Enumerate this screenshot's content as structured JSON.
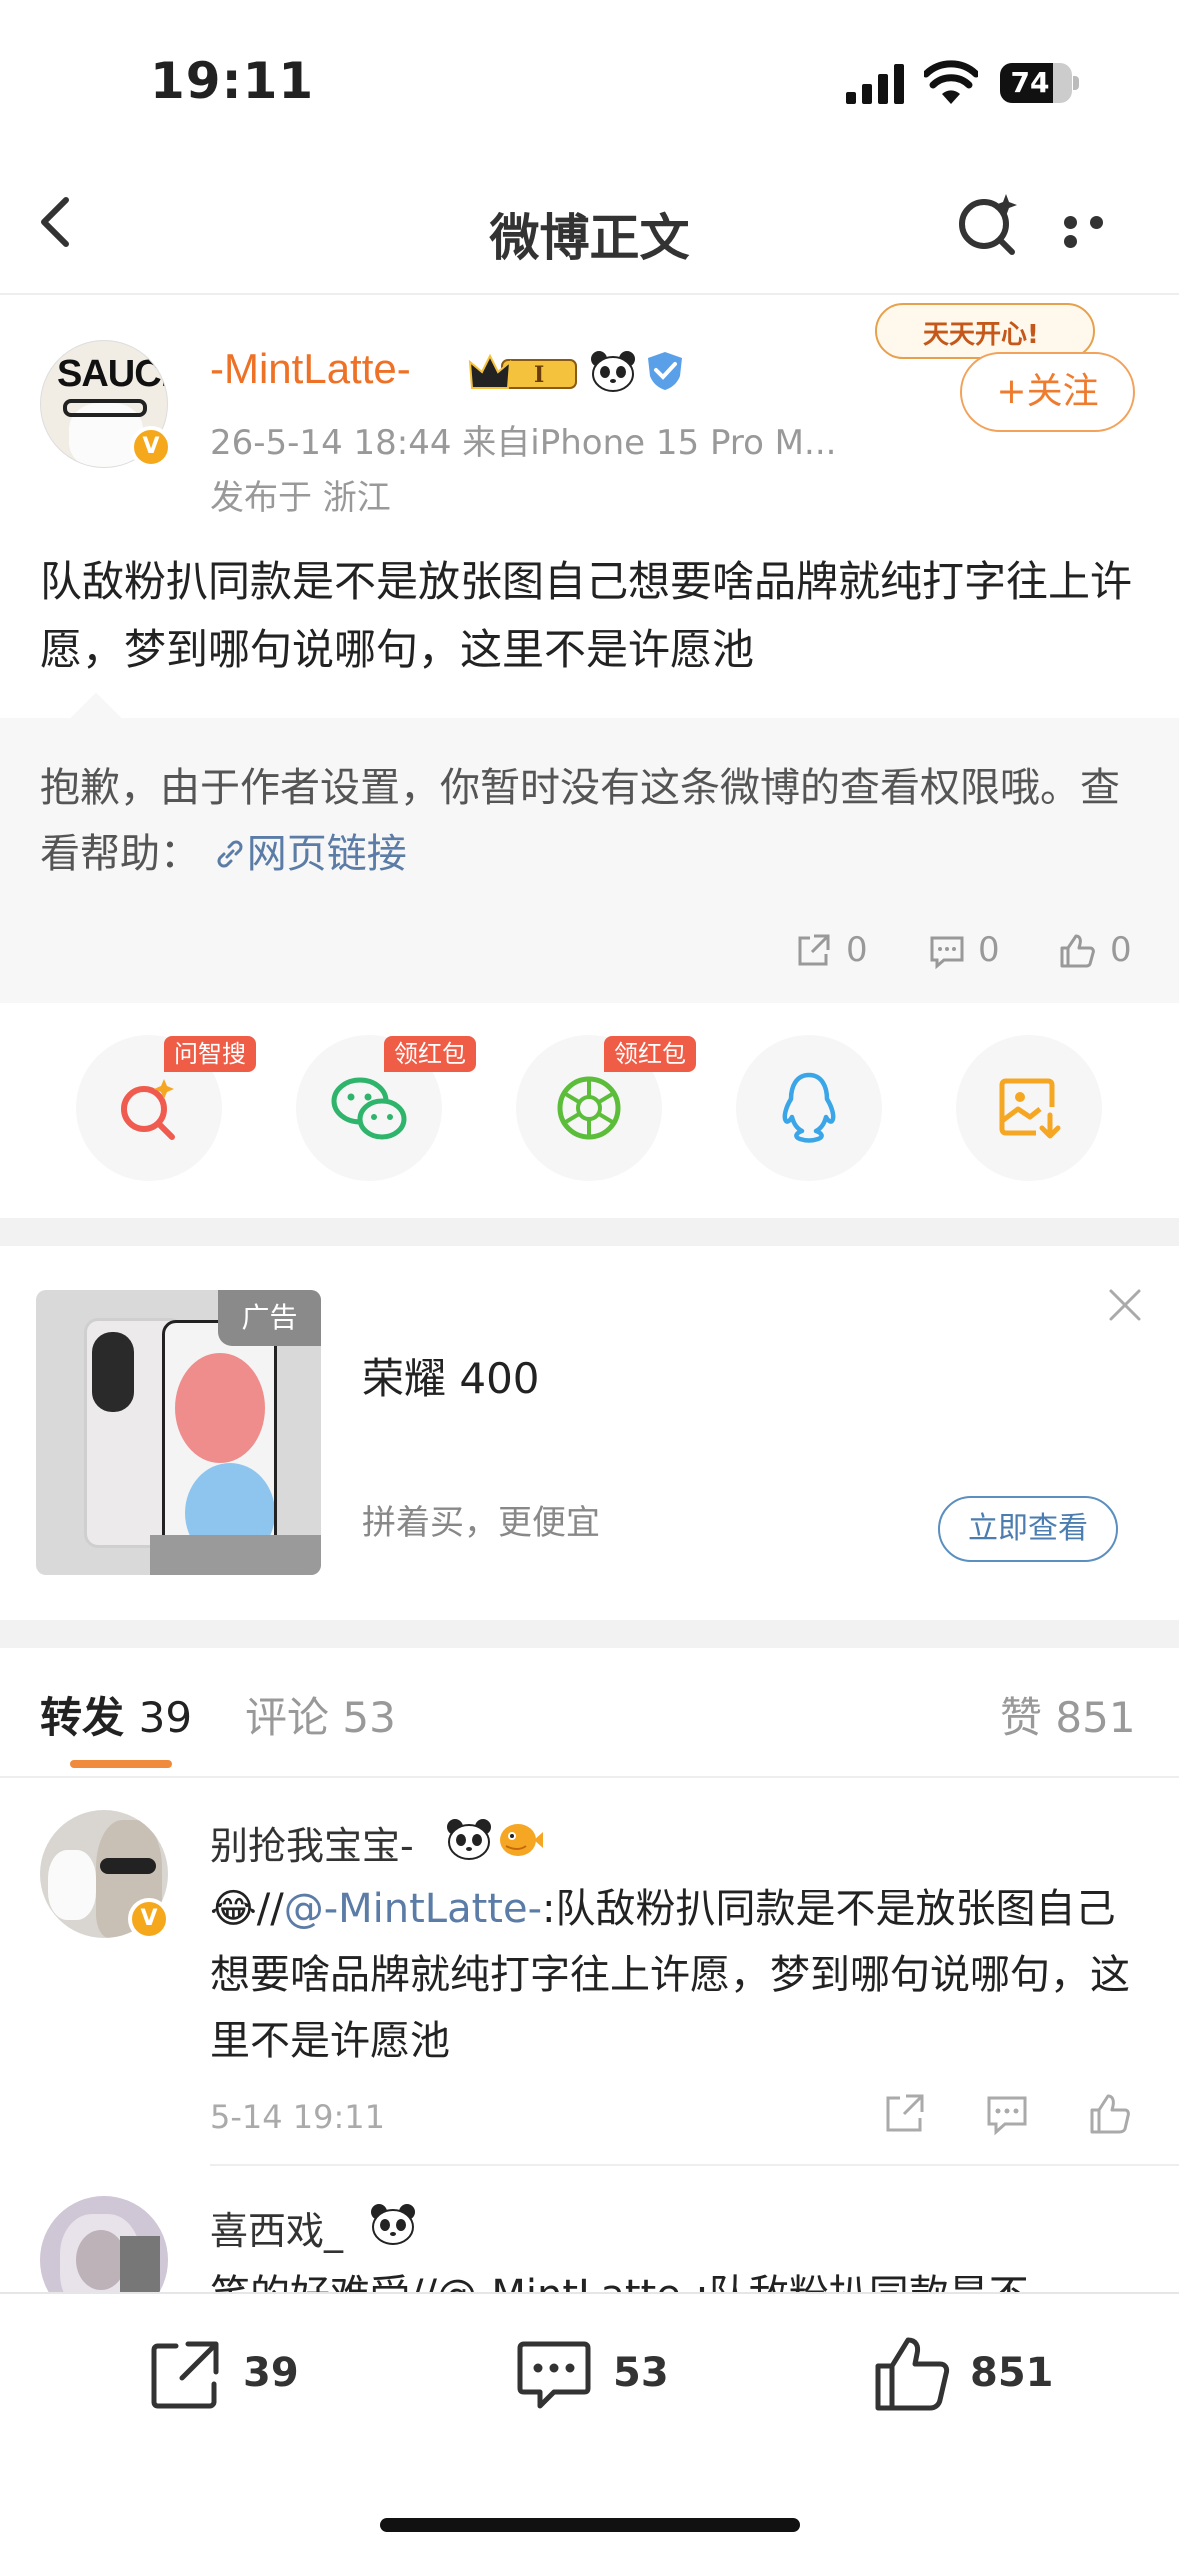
{
  "status_bar": {
    "time": "19:11",
    "battery": "74"
  },
  "nav": {
    "title": "微博正文"
  },
  "post": {
    "username": "-MintLatte-",
    "meta": "26-5-14 18:44  来自iPhone 15 Pro M...",
    "location": "发布于 浙江",
    "follow_label": "+关注",
    "decoration_text": "天天开心!",
    "avatar_text": "SAUCE",
    "text": "队敌粉扒同款是不是放张图自己想要啥品牌就纯打字往上许愿，梦到哪句说哪句，这里不是许愿池"
  },
  "retweet_box": {
    "notice": "抱歉，由于作者设置，你暂时没有这条微博的查看权限哦。查看帮助：",
    "link": "网页链接",
    "reposts": "0",
    "comments": "0",
    "likes": "0"
  },
  "share_tags": {
    "search": "问智搜",
    "wechat": "领红包",
    "moments": "领红包"
  },
  "ad": {
    "tag": "广告",
    "title": "荣耀 400",
    "subtitle": "拼着买，更便宜",
    "button": "立即查看"
  },
  "tabs": {
    "repost_label": "转发",
    "repost_count": "39",
    "comment_label": "评论",
    "comment_count": "53",
    "like_label": "赞",
    "like_count": "851"
  },
  "comments": [
    {
      "name": "别抢我宝宝-",
      "emoji": "😂",
      "slashes": "//",
      "mention": "@-MintLatte-",
      "text": ":队敌粉扒同款是不是放张图自己想要啥品牌就纯打字往上许愿，梦到哪句说哪句，这里不是许愿池",
      "time": "5-14 19:11"
    },
    {
      "name": "喜西戏_",
      "text": "笑的好难受//@-MintLatte-:队敌粉扒同款是不"
    }
  ],
  "bottom_bar": {
    "reposts": "39",
    "comments": "53",
    "likes": "851"
  },
  "colors": {
    "accent": "#ee7125",
    "link": "#5b7ca6",
    "tag_red": "#f05d47"
  }
}
